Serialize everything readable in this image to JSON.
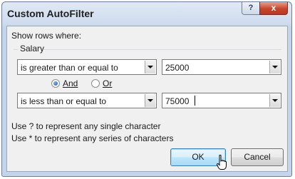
{
  "window": {
    "title": "Custom AutoFilter",
    "help_label": "?",
    "close_label": "x"
  },
  "dialog": {
    "show_rows_label": "Show rows where:",
    "field_name": "Salary",
    "condition1": {
      "operator": "is greater than or equal to",
      "value": "25000"
    },
    "logic": {
      "and_label": "And",
      "or_label": "Or",
      "selected": "And"
    },
    "condition2": {
      "operator": "is less than or equal to",
      "value": "75000"
    },
    "hint1": "Use ? to represent any single character",
    "hint2": "Use * to represent any series of characters",
    "ok_label": "OK",
    "cancel_label": "Cancel"
  },
  "colors": {
    "accent": "#3c7fb1",
    "close": "#c5452c",
    "radio_selected": "#1e5aa8"
  }
}
